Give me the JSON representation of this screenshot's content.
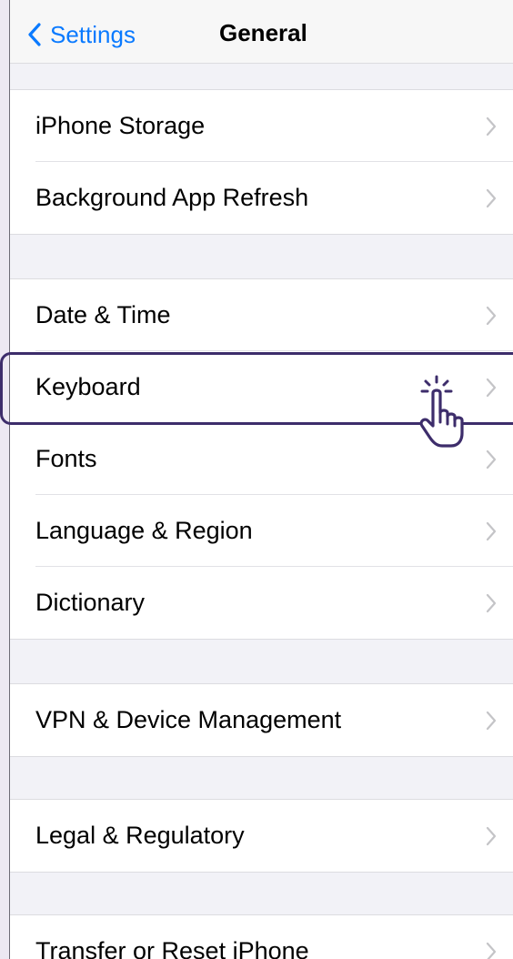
{
  "navbar": {
    "back_label": "Settings",
    "title": "General"
  },
  "groups": [
    {
      "items": [
        {
          "label": "iPhone Storage"
        },
        {
          "label": "Background App Refresh"
        }
      ]
    },
    {
      "items": [
        {
          "label": "Date & Time"
        },
        {
          "label": "Keyboard"
        },
        {
          "label": "Fonts"
        },
        {
          "label": "Language & Region"
        },
        {
          "label": "Dictionary"
        }
      ]
    },
    {
      "items": [
        {
          "label": "VPN & Device Management"
        }
      ]
    },
    {
      "items": [
        {
          "label": "Legal & Regulatory"
        }
      ]
    },
    {
      "items": [
        {
          "label": "Transfer or Reset iPhone"
        }
      ]
    }
  ],
  "highlight": {
    "target": "Keyboard",
    "color": "#3d2d6b"
  },
  "icons": {
    "back": "chevron-left-icon",
    "disclosure": "chevron-right-icon",
    "tap_indicator": "hand-pointer-icon"
  },
  "colors": {
    "accent": "#0a7aff",
    "background": "#f2f2f7",
    "cell": "#ffffff"
  }
}
